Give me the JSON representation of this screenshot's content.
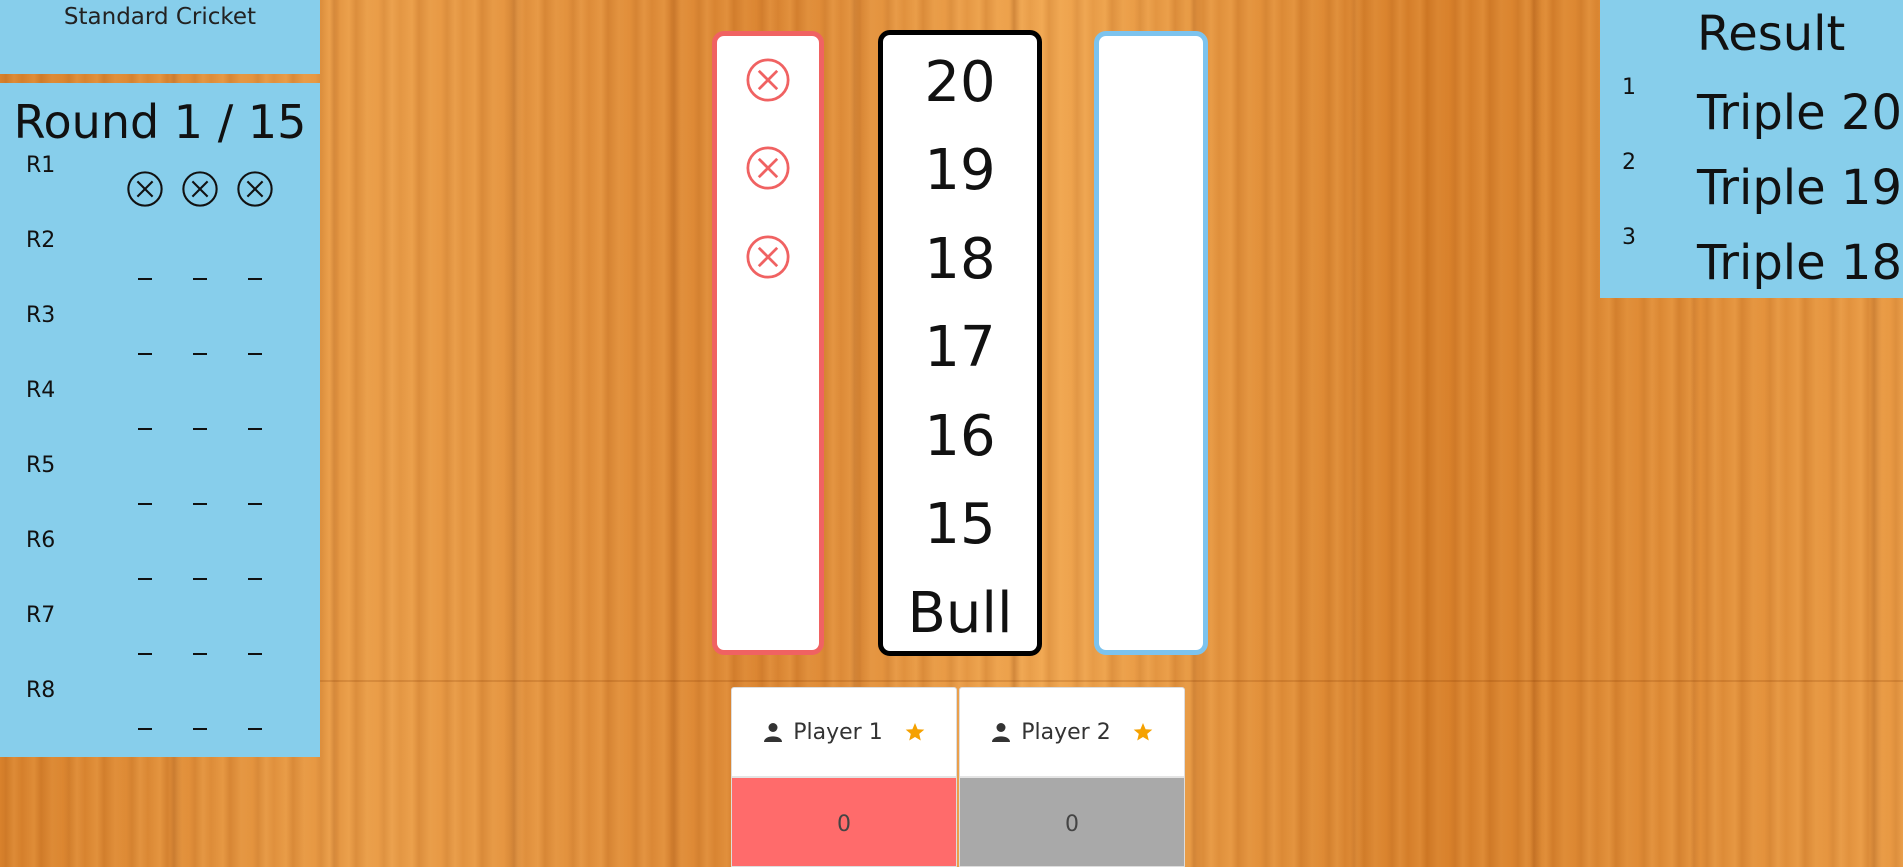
{
  "game": {
    "title": "Standard Cricket",
    "round_label": "Round 1 / 15"
  },
  "rounds": [
    {
      "label": "R1",
      "marks": [
        "miss",
        "miss",
        "miss"
      ]
    },
    {
      "label": "R2",
      "marks": [
        "-",
        "-",
        "-"
      ]
    },
    {
      "label": "R3",
      "marks": [
        "-",
        "-",
        "-"
      ]
    },
    {
      "label": "R4",
      "marks": [
        "-",
        "-",
        "-"
      ]
    },
    {
      "label": "R5",
      "marks": [
        "-",
        "-",
        "-"
      ]
    },
    {
      "label": "R6",
      "marks": [
        "-",
        "-",
        "-"
      ]
    },
    {
      "label": "R7",
      "marks": [
        "-",
        "-",
        "-"
      ]
    },
    {
      "label": "R8",
      "marks": [
        "-",
        "-",
        "-"
      ]
    }
  ],
  "board": {
    "targets": [
      "20",
      "19",
      "18",
      "17",
      "16",
      "15",
      "Bull"
    ],
    "player1_marks": [
      "miss",
      "miss",
      "miss",
      "",
      "",
      "",
      ""
    ],
    "player2_marks": [
      "",
      "",
      "",
      "",
      "",
      "",
      ""
    ]
  },
  "result": {
    "title": "Result",
    "items": [
      {
        "index": "1",
        "value": "Triple 20"
      },
      {
        "index": "2",
        "value": "Triple 19"
      },
      {
        "index": "3",
        "value": "Triple 18"
      }
    ]
  },
  "players": [
    {
      "name": "Player 1",
      "score": "0",
      "color": "#ff6b6b",
      "icon": "user-icon",
      "badge": "star-icon"
    },
    {
      "name": "Player 2",
      "score": "0",
      "color": "#a9a9a9",
      "icon": "user-icon",
      "badge": "star-icon"
    }
  ],
  "colors": {
    "panel": "#87ceeb",
    "player1": "#f06262",
    "player2": "#7cc3ee",
    "star": "#f5a100",
    "miss": "#f06262"
  }
}
